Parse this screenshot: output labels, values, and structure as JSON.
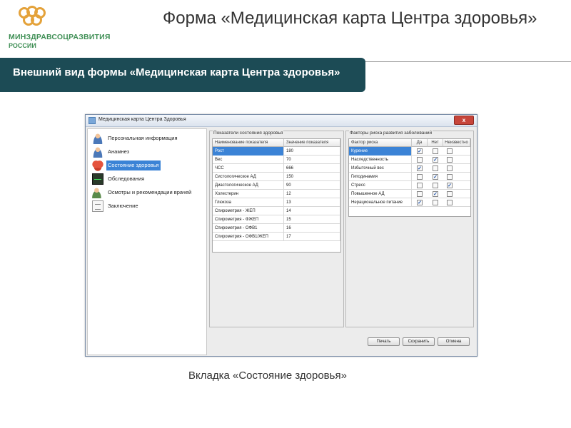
{
  "logo": {
    "line1": "МИНЗДРАВСОЦРАЗВИТИЯ",
    "line2": "РОССИИ",
    "brand_color": "#3f8f55",
    "mark_color": "#e4a23a"
  },
  "slide": {
    "title": "Форма «Медицинская карта Центра здоровья»",
    "subtitle": "Внешний вид формы «Медицинская карта Центра здоровья»",
    "caption": "Вкладка «Состояние здоровья»",
    "band_color": "#1c4b55"
  },
  "window": {
    "title": "Медицинская карта Центра Здоровья",
    "close_label": "x",
    "nav": [
      {
        "label": "Персональная информация",
        "icon": "person-icon",
        "selected": false
      },
      {
        "label": "Анамнез",
        "icon": "person-icon",
        "selected": false
      },
      {
        "label": "Состояние здоровья",
        "icon": "heart-icon",
        "selected": true
      },
      {
        "label": "Обследования",
        "icon": "monitor-icon",
        "selected": false
      },
      {
        "label": "Осмотры и рекомендации врачей",
        "icon": "doctor-icon",
        "selected": false
      },
      {
        "label": "Заключение",
        "icon": "document-icon",
        "selected": false
      }
    ],
    "indicators": {
      "group_title": "Показатели состояния здоровья",
      "col_name": "Наименование показателя",
      "col_value": "Значение показателя",
      "rows": [
        {
          "name": "Рост",
          "value": "180"
        },
        {
          "name": "Вес",
          "value": "70"
        },
        {
          "name": "ЧСС",
          "value": "666"
        },
        {
          "name": "Систологическое АД",
          "value": "150"
        },
        {
          "name": "Диастологическое АД",
          "value": "90"
        },
        {
          "name": "Холестерин",
          "value": "12"
        },
        {
          "name": "Глюкоза",
          "value": "13"
        },
        {
          "name": "Спирометрия - ЖЕП",
          "value": "14"
        },
        {
          "name": "Спирометрия - ФЖЕП",
          "value": "15"
        },
        {
          "name": "Спирометрия - ОФВ1",
          "value": "16"
        },
        {
          "name": "Спирометрия - ОФВ1/ЖЕП",
          "value": "17"
        }
      ]
    },
    "risks": {
      "group_title": "Факторы риска развития заболеваний",
      "col_factor": "Фактор риска",
      "col_yes": "Да",
      "col_no": "Нет",
      "col_unknown": "Неизвестно",
      "rows": [
        {
          "name": "Курение",
          "yes": true,
          "no": false,
          "unknown": false
        },
        {
          "name": "Наследственность",
          "yes": false,
          "no": true,
          "unknown": false
        },
        {
          "name": "Избыточный вес",
          "yes": true,
          "no": false,
          "unknown": false
        },
        {
          "name": "Гиподинамия",
          "yes": false,
          "no": true,
          "unknown": false
        },
        {
          "name": "Стресс",
          "yes": false,
          "no": false,
          "unknown": true
        },
        {
          "name": "Повышенное АД",
          "yes": false,
          "no": true,
          "unknown": false
        },
        {
          "name": "Нерациональное питание",
          "yes": true,
          "no": false,
          "unknown": false
        }
      ]
    },
    "buttons": {
      "print": "Печать",
      "save": "Сохранить",
      "cancel": "Отмена"
    }
  }
}
